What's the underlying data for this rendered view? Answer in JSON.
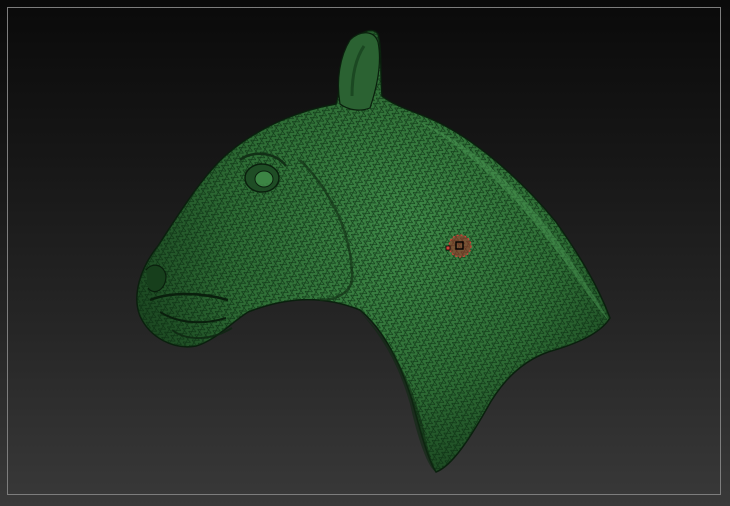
{
  "viewport": {
    "model_name": "",
    "colors": {
      "background_top": "#0a0a0a",
      "background_bottom": "#393939",
      "frame_border": "#7d7d7d",
      "model_material": "#2f6b36",
      "wireframe": "#0c2410",
      "brush_cursor": "#c0392b"
    },
    "icons": {
      "brush_cursor": "brush-cursor-icon"
    }
  }
}
